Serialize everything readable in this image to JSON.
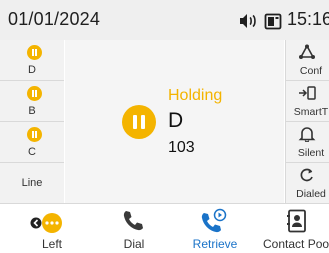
{
  "status_bar": {
    "date": "01/01/2024",
    "time": "15:16",
    "speaker_icon": "speaker-icon",
    "phone_icon": "desk-phone-icon"
  },
  "line_keys": [
    {
      "label": "D",
      "state": "holding"
    },
    {
      "label": "B",
      "state": "holding"
    },
    {
      "label": "C",
      "state": "holding"
    },
    {
      "label": "Line",
      "state": "idle"
    }
  ],
  "call": {
    "status": "Holding",
    "name": "D",
    "number": "103"
  },
  "side_keys": [
    {
      "label": "Conf",
      "icon": "conference-icon"
    },
    {
      "label": "SmartT",
      "icon": "smart-transfer-icon"
    },
    {
      "label": "Silent",
      "icon": "bell-icon"
    },
    {
      "label": "Dialed",
      "icon": "redial-icon"
    }
  ],
  "soft_keys": [
    {
      "label": "Left",
      "icon": "left-more-icon"
    },
    {
      "label": "Dial",
      "icon": "handset-icon"
    },
    {
      "label": "Retrieve",
      "icon": "retrieve-icon"
    },
    {
      "label": "Contact Pool",
      "icon": "contacts-icon"
    }
  ],
  "colors": {
    "hold": "#f4b400",
    "accent": "#1a73c8"
  }
}
